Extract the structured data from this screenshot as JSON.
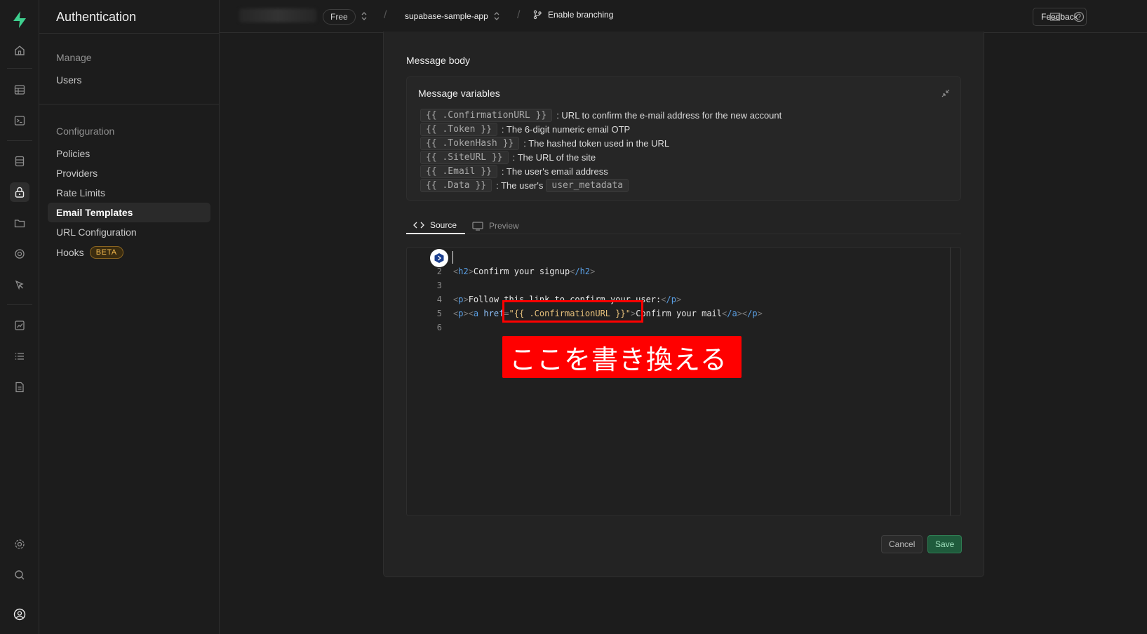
{
  "sidebar": {
    "title": "Authentication",
    "groups": [
      {
        "label": "Manage",
        "items": [
          "Users"
        ]
      },
      {
        "label": "Configuration",
        "items": [
          "Policies",
          "Providers",
          "Rate Limits",
          "Email Templates",
          "URL Configuration",
          "Hooks"
        ]
      }
    ],
    "active_item": "Email Templates",
    "hooks_badge": "BETA"
  },
  "topbar": {
    "plan": "Free",
    "project": "supabase-sample-app",
    "branching": "Enable branching",
    "feedback": "Feedback"
  },
  "card": {
    "heading": "Message body",
    "variables": {
      "title": "Message variables",
      "rows": [
        {
          "code": "{{ .ConfirmationURL }}",
          "desc": ": URL to confirm the e-mail address for the new account"
        },
        {
          "code": "{{ .Token }}",
          "desc": ": The 6-digit numeric email OTP"
        },
        {
          "code": "{{ .TokenHash }}",
          "desc": ": The hashed token used in the URL"
        },
        {
          "code": "{{ .SiteURL }}",
          "desc": ": The URL of the site"
        },
        {
          "code": "{{ .Email }}",
          "desc": ": The user's email address"
        },
        {
          "code": "{{ .Data }}",
          "desc": ": The user's",
          "extra_code": "user_metadata"
        }
      ]
    },
    "tabs": {
      "source": "Source",
      "preview": "Preview"
    },
    "editor": {
      "line_numbers": [
        "2",
        "3",
        "4",
        "5",
        "6"
      ],
      "h2_open": "h2",
      "h2_text": "Confirm your signup",
      "h2_close": "/h2",
      "p_text": "Follow this link to confirm your user:",
      "href_attr": "href",
      "href_value": "{{ .ConfirmationURL }}",
      "link_text": "Confirm your mail"
    },
    "annotation": "ここを書き換える",
    "cancel": "Cancel",
    "save": "Save"
  },
  "colors": {
    "accent": "#3ecf8e",
    "annotation": "#ff0000",
    "save_bg": "#1f5b3c"
  }
}
